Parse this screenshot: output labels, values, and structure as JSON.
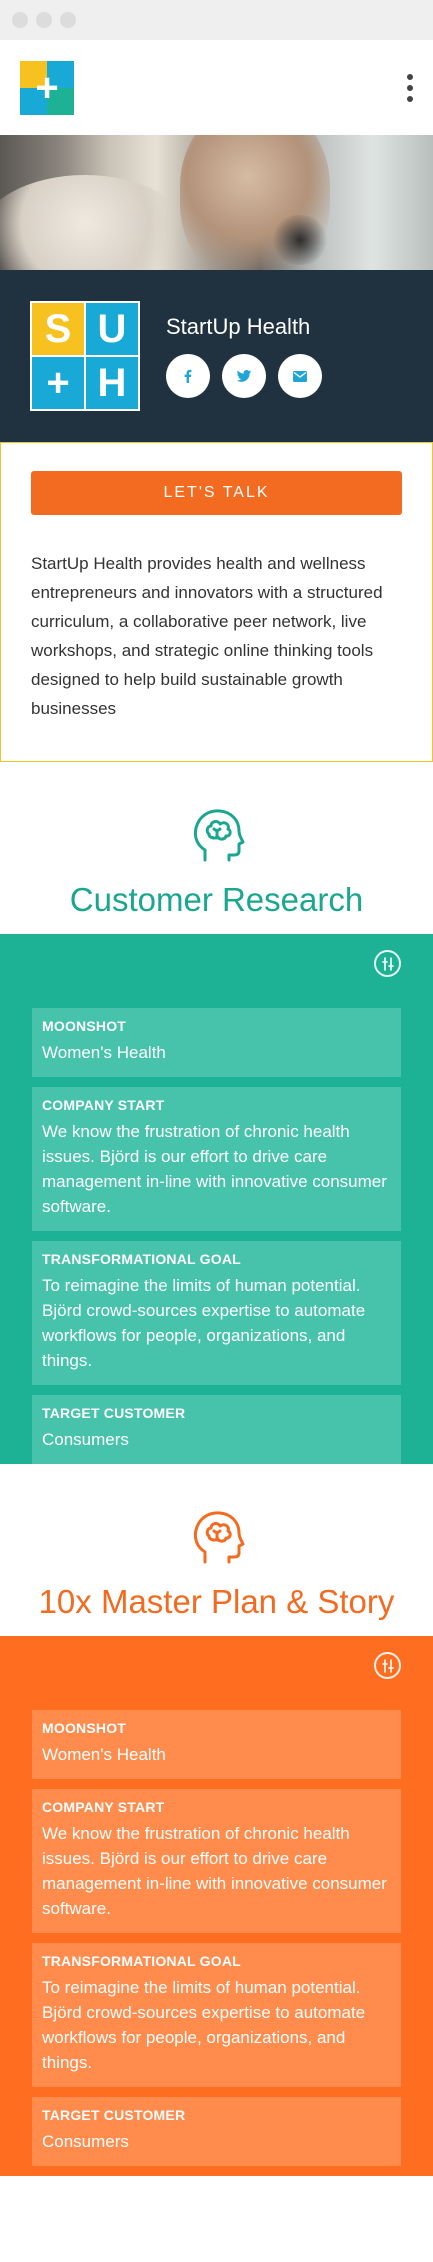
{
  "colors": {
    "teal": "#1db196",
    "teal_card": "#47c3ab",
    "orange": "#ff6e20",
    "orange_card": "#ff8c4d",
    "navy": "#20313f",
    "cta": "#f26b21",
    "logo_yellow": "#f7c21f",
    "logo_blue": "#18a9d6",
    "logo_teal": "#1db196"
  },
  "header": {
    "menu_icon": "kebab-menu-icon"
  },
  "profile": {
    "company_name": "StartUp Health",
    "logo_letters": [
      "S",
      "U",
      "+",
      "H"
    ],
    "social": [
      "facebook-icon",
      "twitter-icon",
      "email-icon"
    ]
  },
  "intro": {
    "cta_label": "LET'S TALK",
    "description": "StartUp Health provides health and wellness entrepreneurs and innovators with a structured curriculum, a collaborative peer network, live workshops, and strategic online thinking tools designed to help build sustainable growth businesses"
  },
  "sections": [
    {
      "title": "Customer Research",
      "icon": "brain-head-icon",
      "cards": [
        {
          "label": "MOONSHOT",
          "value": "Women's Health"
        },
        {
          "label": "COMPANY START",
          "value": "We know the frustration of chronic health issues. Björd is our effort to drive care management in-line with innovative consumer software."
        },
        {
          "label": "TRANSFORMATIONAL GOAL",
          "value": "To reimagine the limits of human potential. Björd crowd-sources expertise to automate workflows for people, organizations, and things."
        },
        {
          "label": "TARGET CUSTOMER",
          "value": "Consumers"
        }
      ]
    },
    {
      "title": "10x Master Plan & Story",
      "icon": "brain-head-icon",
      "cards": [
        {
          "label": "MOONSHOT",
          "value": "Women's Health"
        },
        {
          "label": "COMPANY START",
          "value": "We know the frustration of chronic health issues. Björd is our effort to drive care management in-line with innovative consumer software."
        },
        {
          "label": "TRANSFORMATIONAL GOAL",
          "value": "To reimagine the limits of human potential. Björd crowd-sources expertise to automate workflows for people, organizations, and things."
        },
        {
          "label": "TARGET CUSTOMER",
          "value": "Consumers"
        }
      ]
    }
  ]
}
